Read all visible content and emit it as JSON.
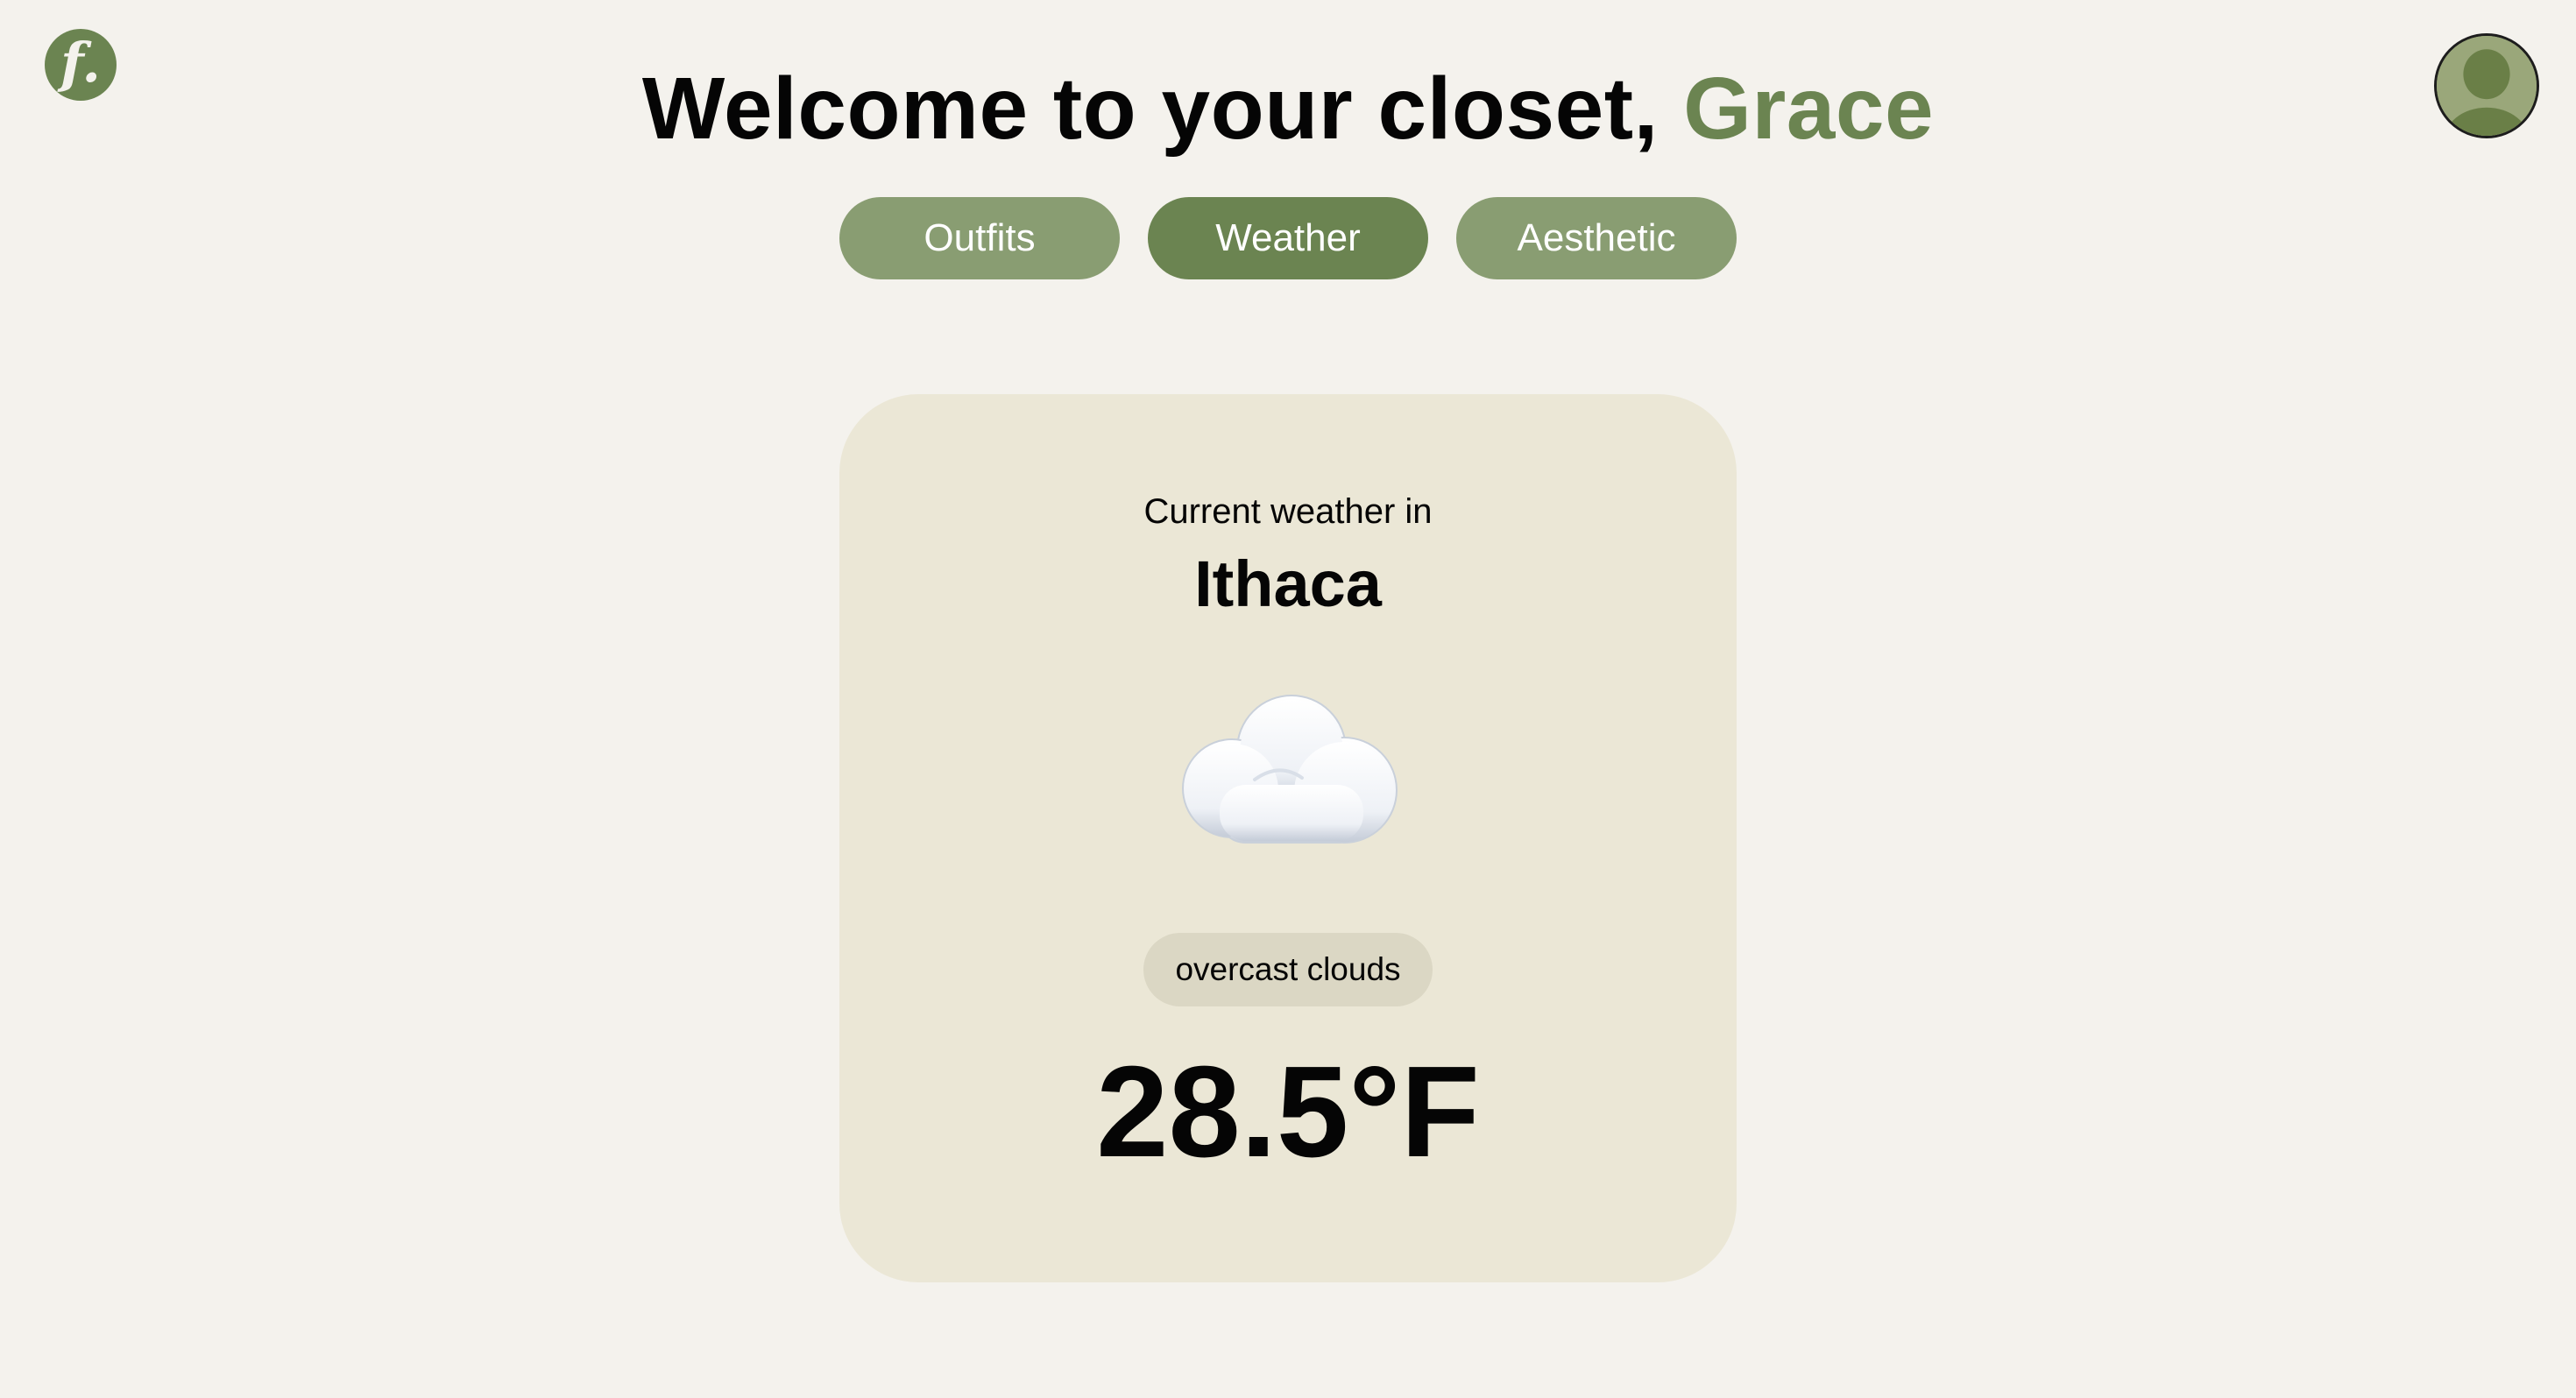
{
  "app": {
    "logo_text": "f.",
    "avatar_icon": "user-avatar-icon"
  },
  "header": {
    "greeting": "Welcome to your closet,",
    "user_name": "Grace"
  },
  "tabs": [
    {
      "label": "Outfits",
      "active": false
    },
    {
      "label": "Weather",
      "active": true
    },
    {
      "label": "Aesthetic",
      "active": false
    }
  ],
  "weather": {
    "intro": "Current weather in",
    "city": "Ithaca",
    "icon": "cloud-icon",
    "condition": "overcast clouds",
    "temperature": "28.5°F"
  },
  "colors": {
    "accent": "#6b8451",
    "tab_inactive": "#899d72",
    "background": "#f4f2ed",
    "card": "#ebe7d6",
    "badge": "#dbd7c4"
  }
}
